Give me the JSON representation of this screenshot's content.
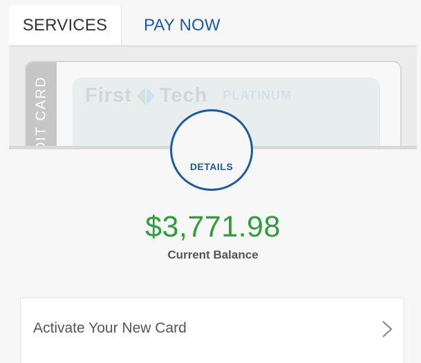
{
  "tabs": [
    {
      "label": "SERVICES",
      "selected": true
    },
    {
      "label": "PAY NOW",
      "selected": false
    }
  ],
  "card": {
    "side_label": "DIT CARD",
    "brand_left": "First",
    "brand_right": "Tech",
    "tier": "PLATINUM"
  },
  "details": {
    "label": "DETAILS"
  },
  "balance": {
    "amount": "$3,771.98",
    "label": "Current Balance"
  },
  "activate": {
    "label": "Activate Your New Card"
  },
  "colors": {
    "accent_blue": "#1c5aa6",
    "balance_green": "#2e9e3a",
    "text_gray": "#555555",
    "background": "#f7f7f7"
  },
  "icons": {
    "brand_logo": "diamond-logo-icon",
    "row_action": "chevron-right-icon"
  }
}
